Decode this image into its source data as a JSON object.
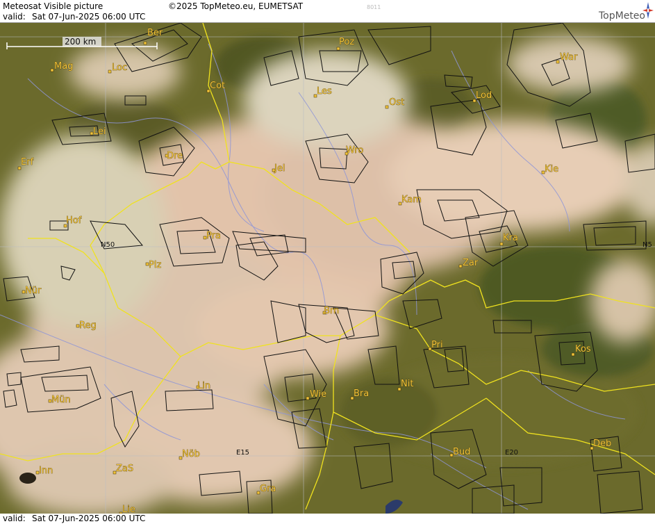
{
  "header": {
    "title": "Meteosat Visible picture",
    "copyright": "©2025 TopMeteo.eu, EUMETSAT",
    "code": "8011",
    "valid_label": "valid:",
    "valid_value": "Sat  07-Jun-2025  06:00 UTC",
    "logo": "TopMeteo"
  },
  "scale": {
    "label": "200 km"
  },
  "footer": {
    "valid_label": "valid:",
    "valid_value": "Sat  07-Jun-2025  06:00 UTC"
  },
  "grid_labels": {
    "n50": "N50",
    "e15": "E15",
    "e20": "E20",
    "n5_right": "N5"
  },
  "cities": [
    {
      "name": "Ber"
    },
    {
      "name": "Poz"
    },
    {
      "name": "War"
    },
    {
      "name": "Mag"
    },
    {
      "name": "Loc"
    },
    {
      "name": "Cot"
    },
    {
      "name": "Les"
    },
    {
      "name": "Ost"
    },
    {
      "name": "Lod"
    },
    {
      "name": "Lei"
    },
    {
      "name": "Dre"
    },
    {
      "name": "Wro"
    },
    {
      "name": "Erf"
    },
    {
      "name": "Jel"
    },
    {
      "name": "Kie"
    },
    {
      "name": "Kam"
    },
    {
      "name": "Hof"
    },
    {
      "name": "Pra"
    },
    {
      "name": "Kra"
    },
    {
      "name": "Plz"
    },
    {
      "name": "Zar"
    },
    {
      "name": "Nür"
    },
    {
      "name": "Brn"
    },
    {
      "name": "Reg"
    },
    {
      "name": "Pri"
    },
    {
      "name": "Kos"
    },
    {
      "name": "Nit"
    },
    {
      "name": "Lin"
    },
    {
      "name": "Wie"
    },
    {
      "name": "Bra"
    },
    {
      "name": "Mün"
    },
    {
      "name": "Bud"
    },
    {
      "name": "Deb"
    },
    {
      "name": "Nöb"
    },
    {
      "name": "Inn"
    },
    {
      "name": "ZaS"
    },
    {
      "name": "Gra"
    },
    {
      "name": "Lie"
    }
  ]
}
